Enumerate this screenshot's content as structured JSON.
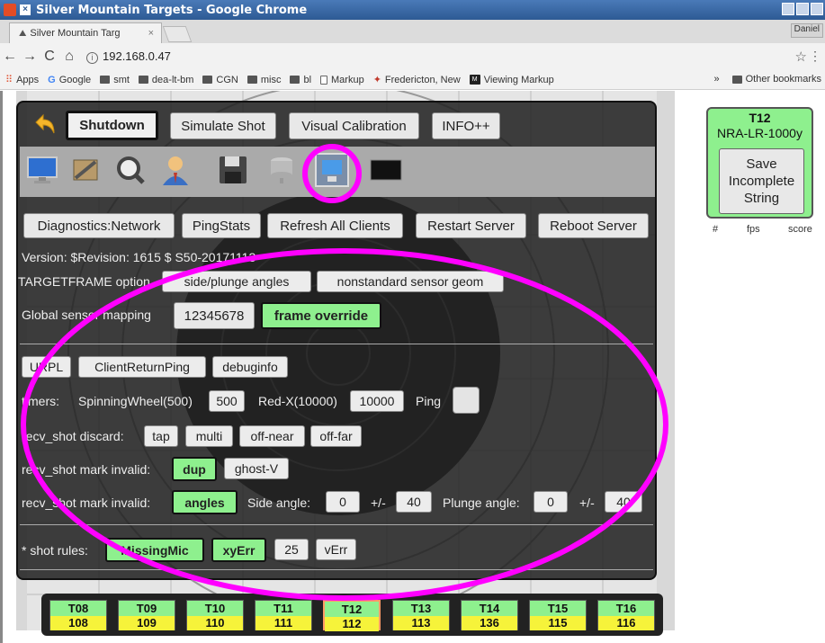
{
  "browser": {
    "window_title": "Silver Mountain Targets - Google Chrome",
    "tab_title": "Silver Mountain Targ",
    "tab_close": "×",
    "user_label": "Daniel",
    "url": "192.168.0.47",
    "bookmarks": [
      "Apps",
      "Google",
      "smt",
      "dea-lt-bm",
      "CGN",
      "misc",
      "bl",
      "Markup",
      "Fredericton, New",
      "Viewing Markup"
    ],
    "overflow": "»",
    "other_bookmarks": "Other bookmarks"
  },
  "toolbar": {
    "shutdown": "Shutdown",
    "simulate_shot": "Simulate Shot",
    "visual_calibration": "Visual Calibration",
    "info": "INFO++"
  },
  "tool_icons": [
    "monitor-icon",
    "tools-icon",
    "magnifier-icon",
    "user-icon",
    "floppy-disk-icon",
    "database-icon",
    "network-icon",
    "terminal-icon"
  ],
  "network_buttons": {
    "diagnostics": "Diagnostics:Network",
    "pingstats": "PingStats",
    "refresh": "Refresh All Clients",
    "restart": "Restart Server",
    "reboot": "Reboot Server"
  },
  "version": "Version: $Revision: 1615 $ S50-20171113",
  "targetframe": {
    "label": "TARGETFRAME option",
    "side_plunge": "side/plunge angles",
    "nonstandard": "nonstandard sensor geom"
  },
  "sensor_mapping": {
    "label": "Global sensor mapping",
    "value": "12345678",
    "override": "frame override"
  },
  "debug": {
    "urpl": "URPL",
    "client_return_ping": "ClientReturnPing",
    "debuginfo": "debuginfo"
  },
  "timers": {
    "label": "timers:",
    "spinning_label": "SpinningWheel(500)",
    "spinning_value": "500",
    "redx_label": "Red-X(10000)",
    "redx_value": "10000",
    "ping_label": "Ping"
  },
  "discard": {
    "label": "recv_shot discard:",
    "tap": "tap",
    "multi": "multi",
    "off_near": "off-near",
    "off_far": "off-far"
  },
  "mark_invalid_1": {
    "label": "recv_shot mark invalid:",
    "dup": "dup",
    "ghost": "ghost-V"
  },
  "mark_invalid_2": {
    "label": "recv_shot mark invalid:",
    "angles": "angles",
    "side_label": "Side angle:",
    "side_value": "0",
    "pm1": "+/-",
    "side_tol": "40",
    "plunge_label": "Plunge angle:",
    "plunge_value": "0",
    "pm2": "+/-",
    "plunge_tol": "40"
  },
  "shot_rules": {
    "label": "* shot rules:",
    "missing_mic": "MissingMic",
    "xyerr": "xyErr",
    "value": "25",
    "verr": "vErr"
  },
  "side_card": {
    "target": "T12",
    "model": "NRA-LR-1000y",
    "save_line1": "Save",
    "save_line2": "Incomplete",
    "save_line3": "String",
    "col_hash": "#",
    "col_fps": "fps",
    "col_score": "score"
  },
  "targets": [
    {
      "name": "T08",
      "score": "108"
    },
    {
      "name": "T09",
      "score": "109"
    },
    {
      "name": "T10",
      "score": "110"
    },
    {
      "name": "T11",
      "score": "111"
    },
    {
      "name": "T12",
      "score": "112"
    },
    {
      "name": "T13",
      "score": "113"
    },
    {
      "name": "T14",
      "score": "136"
    },
    {
      "name": "T15",
      "score": "115"
    },
    {
      "name": "T16",
      "score": "116"
    }
  ],
  "colors": {
    "green": "#8ef08e",
    "yellow": "#f6f33a",
    "annotation": "#ff00ff",
    "selected": "#ff9a66"
  }
}
